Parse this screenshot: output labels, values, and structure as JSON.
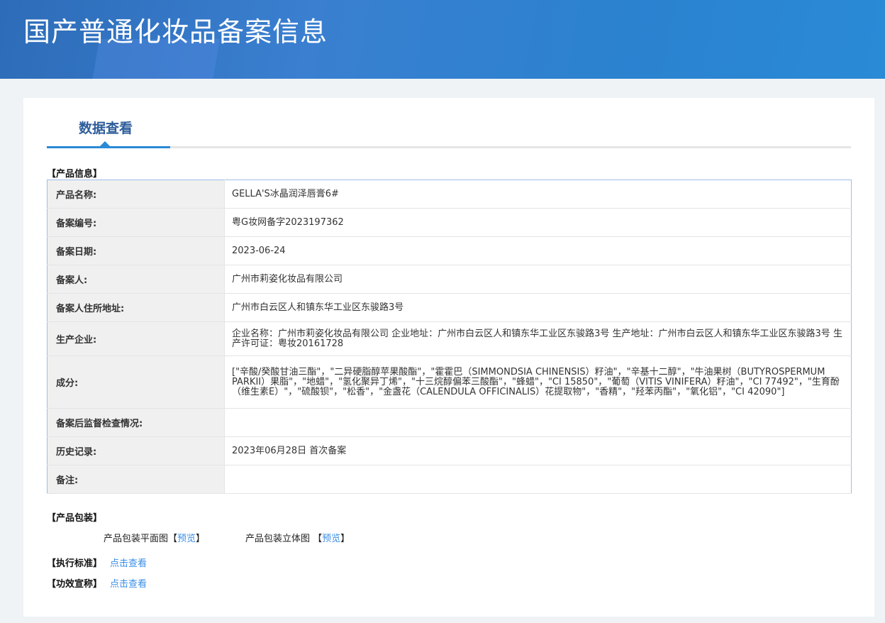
{
  "header": {
    "title": "国产普通化妆品备案信息"
  },
  "tab": {
    "label": "数据查看"
  },
  "product_info": {
    "heading": "【产品信息】",
    "rows": [
      {
        "label": "产品名称:",
        "value": "GELLA'S冰晶润泽唇膏6#"
      },
      {
        "label": "备案编号:",
        "value": "粤G妆网备字2023197362"
      },
      {
        "label": "备案日期:",
        "value": "2023-06-24"
      },
      {
        "label": "备案人:",
        "value": "广州市莉姿化妆品有限公司"
      },
      {
        "label": "备案人住所地址:",
        "value": "广州市白云区人和镇东华工业区东骏路3号"
      },
      {
        "label": "生产企业:",
        "value": "企业名称：广州市莉姿化妆品有限公司 企业地址：广州市白云区人和镇东华工业区东骏路3号 生产地址：广州市白云区人和镇东华工业区东骏路3号 生产许可证：粤妆20161728"
      },
      {
        "label": "成分:",
        "value": "[\"辛酸/癸酸甘油三酯\"，\"二异硬脂醇苹果酸酯\"，\"霍霍巴（SIMMONDSIA CHINENSIS）籽油\"，\"辛基十二醇\"，\"牛油果树（BUTYROSPERMUM PARKII）果脂\"，\"地蜡\"，\"氢化聚异丁烯\"，\"十三烷醇偏苯三酸酯\"，\"蜂蜡\"，\"CI 15850\"，\"葡萄（VITIS VINIFERA）籽油\"，\"CI 77492\"，\"生育酚（维生素E）\"，\"硫酸钡\"，\"松香\"，\"金盏花（CALENDULA OFFICINALIS）花提取物\"，\"香精\"，\"羟苯丙酯\"，\"氧化铝\"，\"CI 42090\"]"
      },
      {
        "label": "备案后监督检查情况:",
        "value": ""
      },
      {
        "label": "历史记录:",
        "value": "2023年06月28日 首次备案"
      },
      {
        "label": "备注:",
        "value": ""
      }
    ]
  },
  "packaging": {
    "heading": "【产品包装】",
    "flat_label": "产品包装平面图",
    "flat_preview": "预览",
    "solid_label": "产品包装立体图 ",
    "solid_preview": "预览",
    "bracket_open": "【",
    "bracket_close": "】"
  },
  "standard": {
    "heading": "【执行标准】",
    "link": "点击查看"
  },
  "claims": {
    "heading": "【功效宣称】",
    "link": "点击查看"
  }
}
